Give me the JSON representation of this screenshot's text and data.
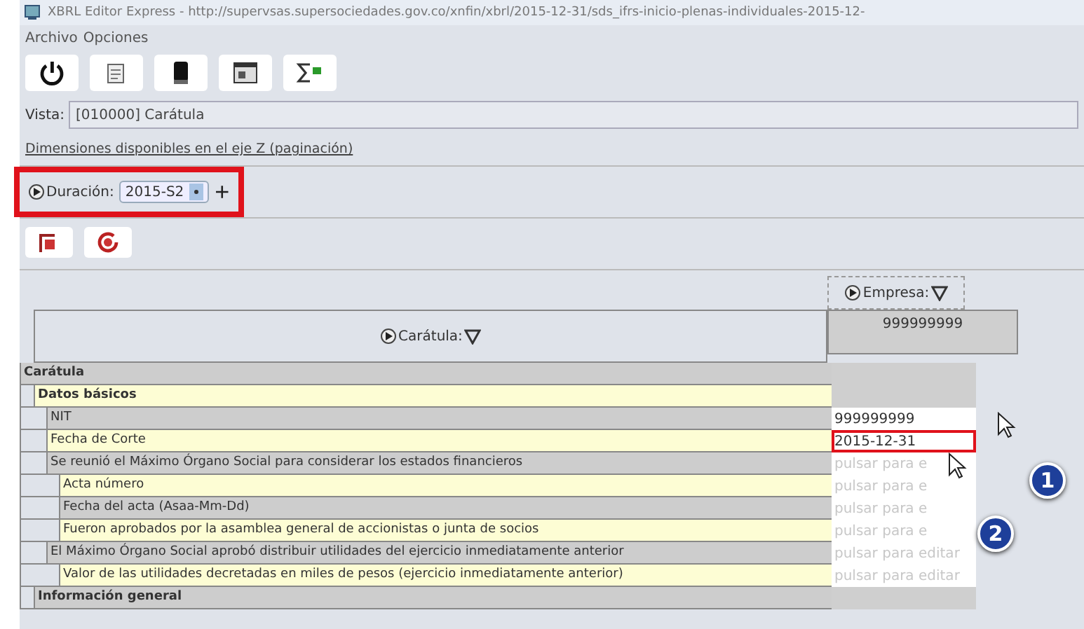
{
  "window": {
    "title": "XBRL Editor Express - http://supervsas.supersociedades.gov.co/xnfin/xbrl/2015-12-31/sds_ifrs-inicio-plenas-individuales-2015-12-"
  },
  "menu": [
    "Archivo",
    "Opciones"
  ],
  "vista": {
    "label": "Vista:",
    "value": "[010000] Carátula"
  },
  "dimensions_caption": "Dimensiones disponibles en el eje Z (paginación)",
  "duration": {
    "label": "Duración:",
    "value": "2015-S2",
    "add": "+"
  },
  "column_header": {
    "label": "Empresa:",
    "value": "999999999"
  },
  "row_header": {
    "label": "Carátula:"
  },
  "rows": [
    {
      "label": "Carátula",
      "bold": true,
      "children": [
        {
          "label": "Datos básicos",
          "bold": true,
          "children": [
            {
              "label": "NIT",
              "value": "999999999",
              "selected": false
            },
            {
              "label": "Fecha de Corte",
              "value": "2015-12-31",
              "selected": true
            },
            {
              "label": "Se reunió el Máximo Órgano Social para considerar los estados financieros",
              "placeholder": "pulsar para e",
              "selected": false,
              "children": [
                {
                  "label": "Acta número",
                  "placeholder": "pulsar para e",
                  "selected": false
                },
                {
                  "label": "Fecha del acta (Asaa-Mm-Dd)",
                  "placeholder": "pulsar para e",
                  "selected": false
                },
                {
                  "label": "Fueron aprobados por la asamblea general de accionistas o junta de socios",
                  "placeholder": "pulsar para e",
                  "selected": false
                }
              ]
            },
            {
              "label": "El Máximo Órgano Social aprobó distribuir utilidades del ejercicio inmediatamente anterior",
              "placeholder": "pulsar para editar",
              "selected": false,
              "children": [
                {
                  "label": "Valor de las utilidades decretadas en miles de pesos (ejercicio inmediatamente anterior)",
                  "placeholder": "pulsar para editar",
                  "selected": false
                }
              ]
            }
          ]
        },
        {
          "label": "Información general",
          "bold": true
        }
      ]
    }
  ],
  "callouts": [
    "1",
    "2"
  ]
}
